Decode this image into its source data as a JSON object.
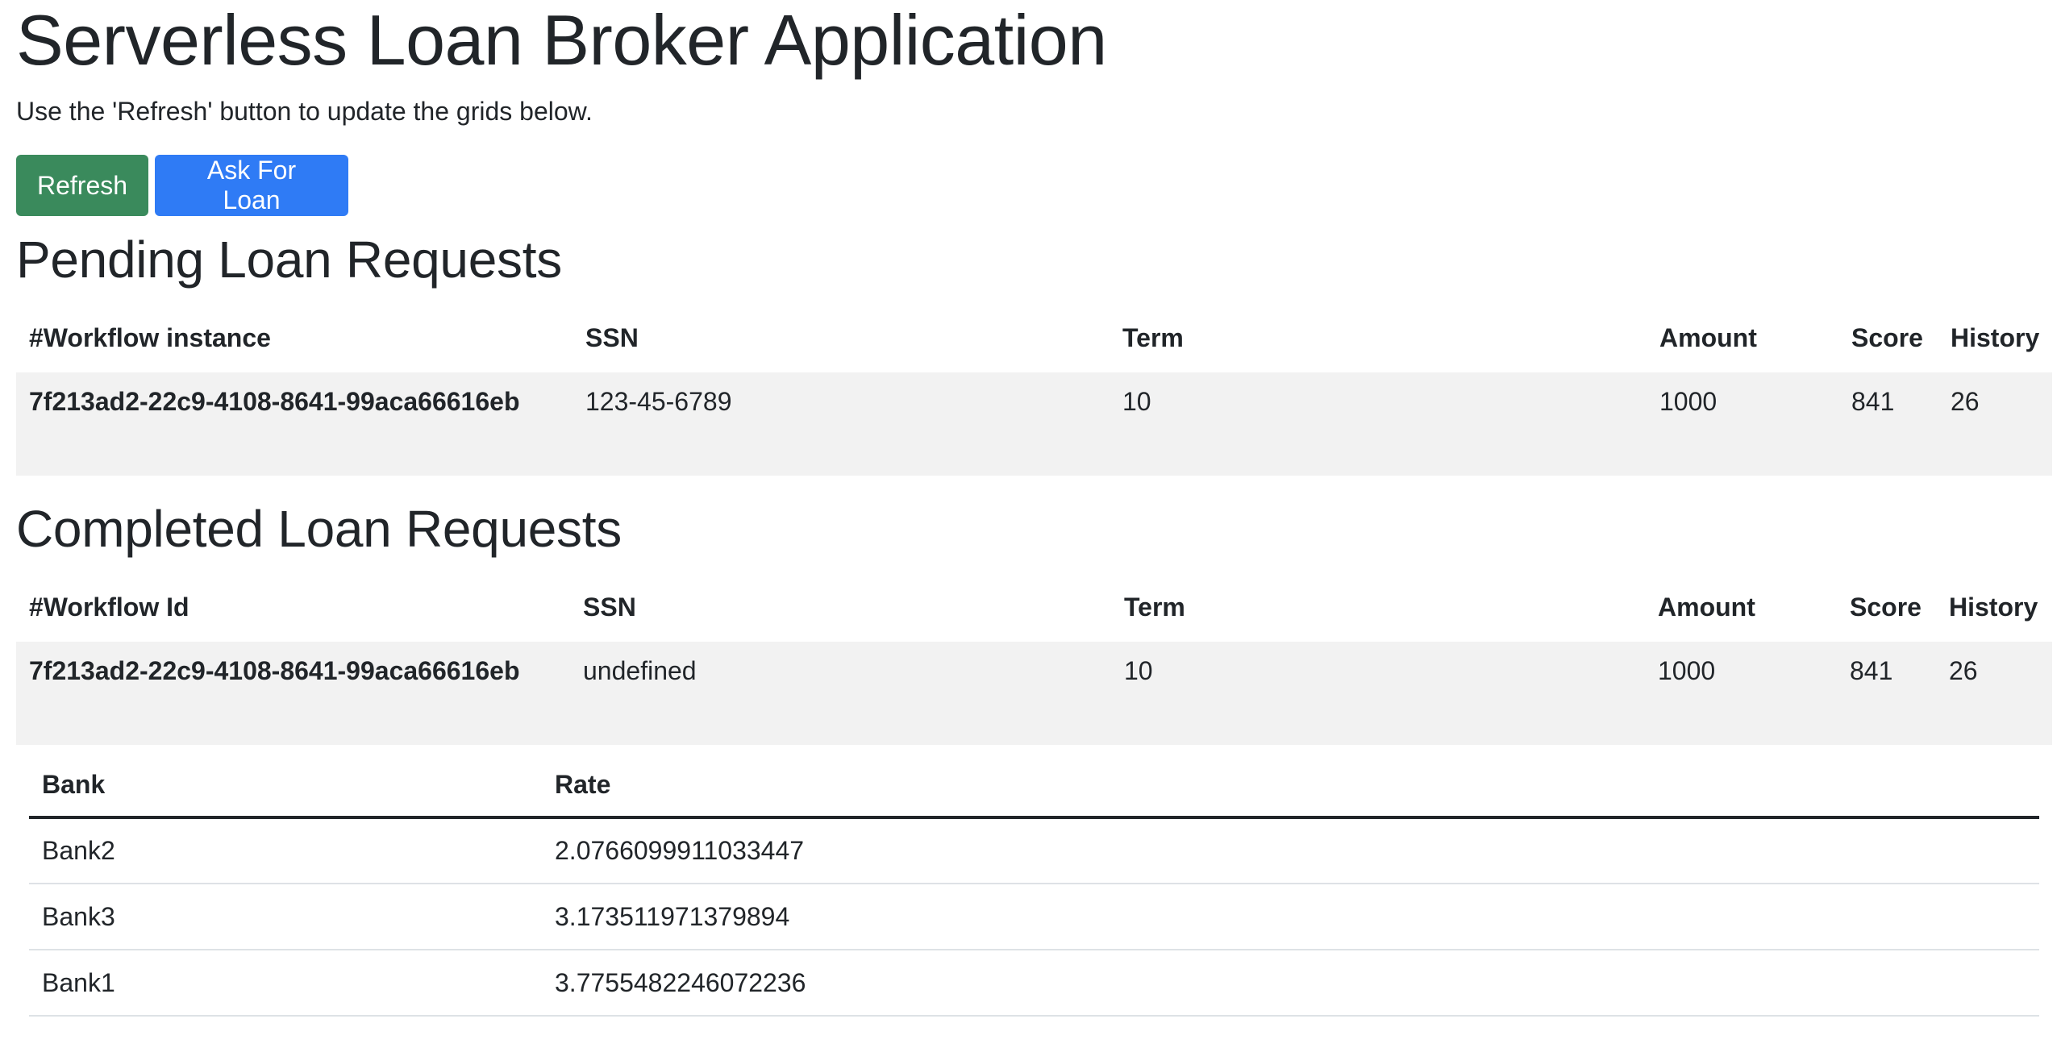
{
  "header": {
    "title": "Serverless Loan Broker Application",
    "intro": "Use the 'Refresh' button to update the grids below."
  },
  "buttons": {
    "refresh_label": "Refresh",
    "ask_loan_label": "Ask For Loan"
  },
  "colors": {
    "refresh_button": "#3a8a5c",
    "ask_loan_button": "#2f7bf5",
    "row_background": "#f2f2f2",
    "text": "#212529"
  },
  "pending": {
    "title": "Pending Loan Requests",
    "columns": [
      "#Workflow instance",
      "SSN",
      "Term",
      "Amount",
      "Score",
      "History"
    ],
    "rows": [
      {
        "workflow": "7f213ad2-22c9-4108-8641-99aca66616eb",
        "ssn": "123-45-6789",
        "term": "10",
        "amount": "1000",
        "score": "841",
        "history": "26"
      }
    ]
  },
  "completed": {
    "title": "Completed Loan Requests",
    "columns": [
      "#Workflow Id",
      "SSN",
      "Term",
      "Amount",
      "Score",
      "History"
    ],
    "rows": [
      {
        "workflow": "7f213ad2-22c9-4108-8641-99aca66616eb",
        "ssn": "undefined",
        "term": "10",
        "amount": "1000",
        "score": "841",
        "history": "26"
      }
    ],
    "quotes": {
      "columns": [
        "Bank",
        "Rate"
      ],
      "rows": [
        {
          "bank": "Bank2",
          "rate": "2.0766099911033447"
        },
        {
          "bank": "Bank3",
          "rate": "3.173511971379894"
        },
        {
          "bank": "Bank1",
          "rate": "3.7755482246072236"
        }
      ]
    }
  }
}
